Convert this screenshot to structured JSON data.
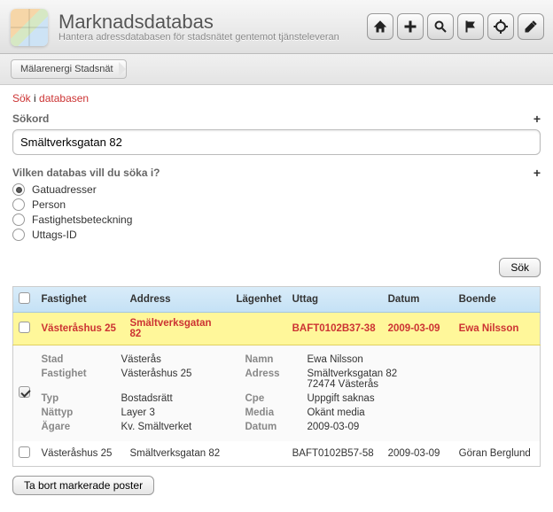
{
  "header": {
    "title": "Marknadsdatabas",
    "subtitle": "Hantera adressdatabasen för stadsnätet gentemot tjänsteleveran"
  },
  "breadcrumb": {
    "item": "Mälarenergi Stadsnät"
  },
  "search": {
    "heading_red1": "Sök",
    "heading_black": "i",
    "heading_red2": "databasen",
    "keyword_label": "Sökord",
    "keyword_value": "Smältverksgatan 82",
    "db_label": "Vilken databas vill du söka i?",
    "options": {
      "gatuadresser": "Gatuadresser",
      "person": "Person",
      "fastighet": "Fastighetsbeteckning",
      "uttags": "Uttags-ID"
    },
    "selected": "gatuadresser",
    "button": "Sök"
  },
  "table": {
    "headers": {
      "fastighet": "Fastighet",
      "address": "Address",
      "lagenhet": "Lägenhet",
      "uttag": "Uttag",
      "datum": "Datum",
      "boende": "Boende"
    },
    "row1": {
      "fastighet": "Västeråshus 25",
      "address": "Smältverksgatan 82",
      "lagenhet": "",
      "uttag": "BAFT0102B37-38",
      "datum": "2009-03-09",
      "boende": "Ewa Nilsson"
    },
    "row3": {
      "fastighet": "Västeråshus 25",
      "address": "Smältverksgatan 82",
      "lagenhet": "",
      "uttag": "BAFT0102B57-58",
      "datum": "2009-03-09",
      "boende": "Göran Berglund"
    }
  },
  "detail": {
    "labels": {
      "stad": "Stad",
      "fastighet": "Fastighet",
      "typ": "Typ",
      "nattyp": "Nättyp",
      "agare": "Ägare",
      "namn": "Namn",
      "adress": "Adress",
      "cpe": "Cpe",
      "media": "Media",
      "datum": "Datum"
    },
    "values": {
      "stad": "Västerås",
      "fastighet": "Västeråshus 25",
      "typ": "Bostadsrätt",
      "nattyp": "Layer 3",
      "agare": "Kv. Smältverket",
      "namn": "Ewa Nilsson",
      "adress_line1": "Smältverksgatan 82",
      "adress_line2": "72474 Västerås",
      "cpe": "Uppgift saknas",
      "media": "Okänt media",
      "datum": "2009-03-09"
    }
  },
  "footer": {
    "delete_button": "Ta bort markerade poster"
  }
}
